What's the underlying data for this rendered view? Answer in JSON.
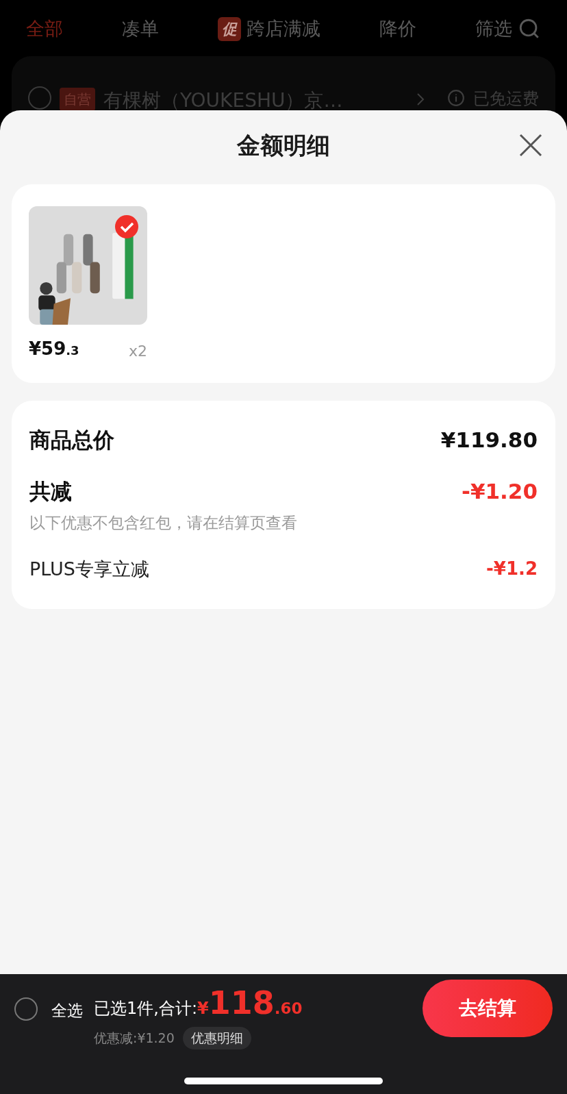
{
  "tabs": [
    {
      "label": "全部",
      "selected": true
    },
    {
      "label": "凑单",
      "selected": false
    },
    {
      "label": "跨店满减",
      "badge": "促",
      "selected": false
    },
    {
      "label": "降价",
      "selected": false
    },
    {
      "label": "筛选",
      "selected": false
    }
  ],
  "store": {
    "checked": false,
    "tag": "自营",
    "name": "有棵树（YOUKESHU）京…",
    "shipping": "已免运费"
  },
  "sheet": {
    "title": "金额明细",
    "products": [
      {
        "selected": true,
        "price_main": "¥59",
        "price_decimal": ".3",
        "quantity": "x2"
      }
    ],
    "summary": {
      "total_label": "商品总价",
      "total_value": "¥119.80",
      "discount_label": "共减",
      "discount_value": "-¥1.20",
      "note": "以下优惠不包含红包，请在结算页查看",
      "items": [
        {
          "label": "PLUS专享立减",
          "value": "-¥1.2"
        }
      ]
    }
  },
  "footer": {
    "select_all": {
      "label": "全选",
      "checked": false
    },
    "selected_text": "已选1件,合计:",
    "currency": "¥",
    "total_main": "118",
    "total_decimal": ".60",
    "discount_text": "优惠减:¥1.20",
    "detail_button": "优惠明细",
    "checkout_button": "去结算"
  }
}
